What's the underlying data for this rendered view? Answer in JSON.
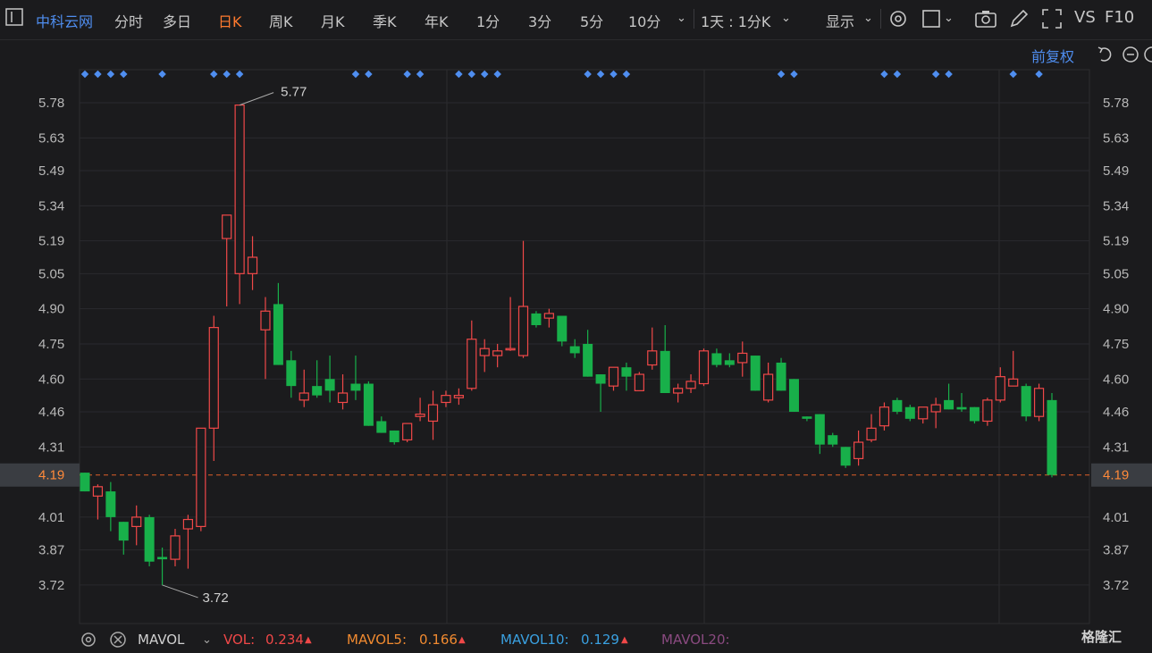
{
  "toolbar": {
    "stock_name": "中科云网",
    "periods": [
      "分时",
      "多日",
      "日K",
      "周K",
      "月K",
      "季K",
      "年K",
      "1分",
      "3分",
      "5分",
      "10分"
    ],
    "active_period": "日K",
    "interval_select": "1天 : 1分K",
    "display_label": "显示",
    "vs_label": "VS",
    "f10_label": "F10",
    "adjust_label": "前复权"
  },
  "colors": {
    "up": "#f04848",
    "down": "#18b04a",
    "accent": "#ff7a2e",
    "blue": "#4f8ef0"
  },
  "chart_data": {
    "type": "candlestick",
    "y_ticks": [
      "5.78",
      "5.63",
      "5.49",
      "5.34",
      "5.19",
      "5.05",
      "4.90",
      "4.75",
      "4.60",
      "4.46",
      "4.31",
      "4.19",
      "4.01",
      "3.87",
      "3.72"
    ],
    "ylim": [
      3.62,
      5.9
    ],
    "current_price": "4.19",
    "max_label": "5.77",
    "min_label": "3.72",
    "candles": [
      {
        "o": 4.2,
        "h": 4.2,
        "l": 4.12,
        "c": 4.12
      },
      {
        "o": 4.1,
        "h": 4.15,
        "l": 4.0,
        "c": 4.14
      },
      {
        "o": 4.12,
        "h": 4.16,
        "l": 3.95,
        "c": 4.01
      },
      {
        "o": 3.99,
        "h": 3.99,
        "l": 3.85,
        "c": 3.91
      },
      {
        "o": 3.97,
        "h": 4.06,
        "l": 3.89,
        "c": 4.01
      },
      {
        "o": 4.01,
        "h": 4.02,
        "l": 3.8,
        "c": 3.82
      },
      {
        "o": 3.84,
        "h": 3.88,
        "l": 3.72,
        "c": 3.83
      },
      {
        "o": 3.83,
        "h": 3.96,
        "l": 3.8,
        "c": 3.93
      },
      {
        "o": 3.96,
        "h": 4.02,
        "l": 3.79,
        "c": 4.0
      },
      {
        "o": 3.97,
        "h": 4.39,
        "l": 3.95,
        "c": 4.39
      },
      {
        "o": 4.39,
        "h": 4.87,
        "l": 4.25,
        "c": 4.82
      },
      {
        "o": 5.2,
        "h": 5.3,
        "l": 4.91,
        "c": 5.3
      },
      {
        "o": 5.05,
        "h": 5.77,
        "l": 4.92,
        "c": 5.77
      },
      {
        "o": 5.05,
        "h": 5.21,
        "l": 4.98,
        "c": 5.12
      },
      {
        "o": 4.81,
        "h": 4.95,
        "l": 4.6,
        "c": 4.89
      },
      {
        "o": 4.92,
        "h": 5.01,
        "l": 4.66,
        "c": 4.66
      },
      {
        "o": 4.68,
        "h": 4.72,
        "l": 4.52,
        "c": 4.57
      },
      {
        "o": 4.51,
        "h": 4.64,
        "l": 4.48,
        "c": 4.54
      },
      {
        "o": 4.57,
        "h": 4.68,
        "l": 4.52,
        "c": 4.53
      },
      {
        "o": 4.6,
        "h": 4.7,
        "l": 4.5,
        "c": 4.55
      },
      {
        "o": 4.5,
        "h": 4.62,
        "l": 4.47,
        "c": 4.54
      },
      {
        "o": 4.58,
        "h": 4.7,
        "l": 4.51,
        "c": 4.55
      },
      {
        "o": 4.58,
        "h": 4.59,
        "l": 4.4,
        "c": 4.4
      },
      {
        "o": 4.42,
        "h": 4.44,
        "l": 4.37,
        "c": 4.37
      },
      {
        "o": 4.38,
        "h": 4.38,
        "l": 4.32,
        "c": 4.33
      },
      {
        "o": 4.34,
        "h": 4.41,
        "l": 4.33,
        "c": 4.41
      },
      {
        "o": 4.44,
        "h": 4.52,
        "l": 4.42,
        "c": 4.45
      },
      {
        "o": 4.42,
        "h": 4.55,
        "l": 4.34,
        "c": 4.49
      },
      {
        "o": 4.5,
        "h": 4.55,
        "l": 4.48,
        "c": 4.53
      },
      {
        "o": 4.52,
        "h": 4.56,
        "l": 4.49,
        "c": 4.53
      },
      {
        "o": 4.56,
        "h": 4.85,
        "l": 4.55,
        "c": 4.77
      },
      {
        "o": 4.7,
        "h": 4.77,
        "l": 4.63,
        "c": 4.73
      },
      {
        "o": 4.7,
        "h": 4.75,
        "l": 4.65,
        "c": 4.72
      },
      {
        "o": 4.73,
        "h": 4.95,
        "l": 4.72,
        "c": 4.73
      },
      {
        "o": 4.7,
        "h": 5.19,
        "l": 4.69,
        "c": 4.91
      },
      {
        "o": 4.88,
        "h": 4.89,
        "l": 4.82,
        "c": 4.83
      },
      {
        "o": 4.86,
        "h": 4.9,
        "l": 4.82,
        "c": 4.88
      },
      {
        "o": 4.87,
        "h": 4.87,
        "l": 4.74,
        "c": 4.76
      },
      {
        "o": 4.74,
        "h": 4.77,
        "l": 4.69,
        "c": 4.71
      },
      {
        "o": 4.75,
        "h": 4.81,
        "l": 4.61,
        "c": 4.61
      },
      {
        "o": 4.62,
        "h": 4.62,
        "l": 4.46,
        "c": 4.58
      },
      {
        "o": 4.57,
        "h": 4.65,
        "l": 4.55,
        "c": 4.65
      },
      {
        "o": 4.65,
        "h": 4.67,
        "l": 4.55,
        "c": 4.61
      },
      {
        "o": 4.55,
        "h": 4.63,
        "l": 4.55,
        "c": 4.62
      },
      {
        "o": 4.66,
        "h": 4.82,
        "l": 4.64,
        "c": 4.72
      },
      {
        "o": 4.72,
        "h": 4.83,
        "l": 4.54,
        "c": 4.54
      },
      {
        "o": 4.54,
        "h": 4.58,
        "l": 4.5,
        "c": 4.56
      },
      {
        "o": 4.56,
        "h": 4.62,
        "l": 4.54,
        "c": 4.59
      },
      {
        "o": 4.58,
        "h": 4.73,
        "l": 4.57,
        "c": 4.72
      },
      {
        "o": 4.71,
        "h": 4.73,
        "l": 4.65,
        "c": 4.66
      },
      {
        "o": 4.68,
        "h": 4.71,
        "l": 4.65,
        "c": 4.66
      },
      {
        "o": 4.67,
        "h": 4.76,
        "l": 4.61,
        "c": 4.71
      },
      {
        "o": 4.7,
        "h": 4.7,
        "l": 4.55,
        "c": 4.55
      },
      {
        "o": 4.51,
        "h": 4.67,
        "l": 4.5,
        "c": 4.62
      },
      {
        "o": 4.67,
        "h": 4.69,
        "l": 4.55,
        "c": 4.55
      },
      {
        "o": 4.6,
        "h": 4.6,
        "l": 4.46,
        "c": 4.46
      },
      {
        "o": 4.44,
        "h": 4.44,
        "l": 4.42,
        "c": 4.43
      },
      {
        "o": 4.45,
        "h": 4.45,
        "l": 4.28,
        "c": 4.32
      },
      {
        "o": 4.36,
        "h": 4.37,
        "l": 4.31,
        "c": 4.32
      },
      {
        "o": 4.31,
        "h": 4.31,
        "l": 4.22,
        "c": 4.23
      },
      {
        "o": 4.26,
        "h": 4.38,
        "l": 4.23,
        "c": 4.33
      },
      {
        "o": 4.34,
        "h": 4.45,
        "l": 4.33,
        "c": 4.39
      },
      {
        "o": 4.4,
        "h": 4.5,
        "l": 4.38,
        "c": 4.48
      },
      {
        "o": 4.51,
        "h": 4.52,
        "l": 4.45,
        "c": 4.46
      },
      {
        "o": 4.48,
        "h": 4.49,
        "l": 4.42,
        "c": 4.43
      },
      {
        "o": 4.43,
        "h": 4.48,
        "l": 4.41,
        "c": 4.48
      },
      {
        "o": 4.46,
        "h": 4.52,
        "l": 4.39,
        "c": 4.49
      },
      {
        "o": 4.51,
        "h": 4.58,
        "l": 4.47,
        "c": 4.47
      },
      {
        "o": 4.48,
        "h": 4.54,
        "l": 4.46,
        "c": 4.47
      },
      {
        "o": 4.48,
        "h": 4.48,
        "l": 4.41,
        "c": 4.42
      },
      {
        "o": 4.42,
        "h": 4.52,
        "l": 4.4,
        "c": 4.51
      },
      {
        "o": 4.51,
        "h": 4.65,
        "l": 4.5,
        "c": 4.61
      },
      {
        "o": 4.57,
        "h": 4.72,
        "l": 4.57,
        "c": 4.6
      },
      {
        "o": 4.57,
        "h": 4.58,
        "l": 4.42,
        "c": 4.44
      },
      {
        "o": 4.44,
        "h": 4.58,
        "l": 4.42,
        "c": 4.56
      },
      {
        "o": 4.51,
        "h": 4.54,
        "l": 4.18,
        "c": 4.19
      }
    ],
    "signal_dot_indices": [
      0,
      1,
      2,
      3,
      6,
      10,
      11,
      12,
      21,
      22,
      25,
      26,
      29,
      30,
      31,
      32,
      39,
      40,
      41,
      42,
      54,
      55,
      62,
      63,
      66,
      67,
      72,
      74
    ]
  },
  "indicator": {
    "name": "MAVOL",
    "vol_label": "VOL:",
    "vol_value": "0.234",
    "mavol5_label": "MAVOL5:",
    "mavol5_value": "0.166",
    "mavol10_label": "MAVOL10:",
    "mavol10_value": "0.129",
    "mavol20_label": "MAVOL20:"
  },
  "logo": "格隆汇"
}
